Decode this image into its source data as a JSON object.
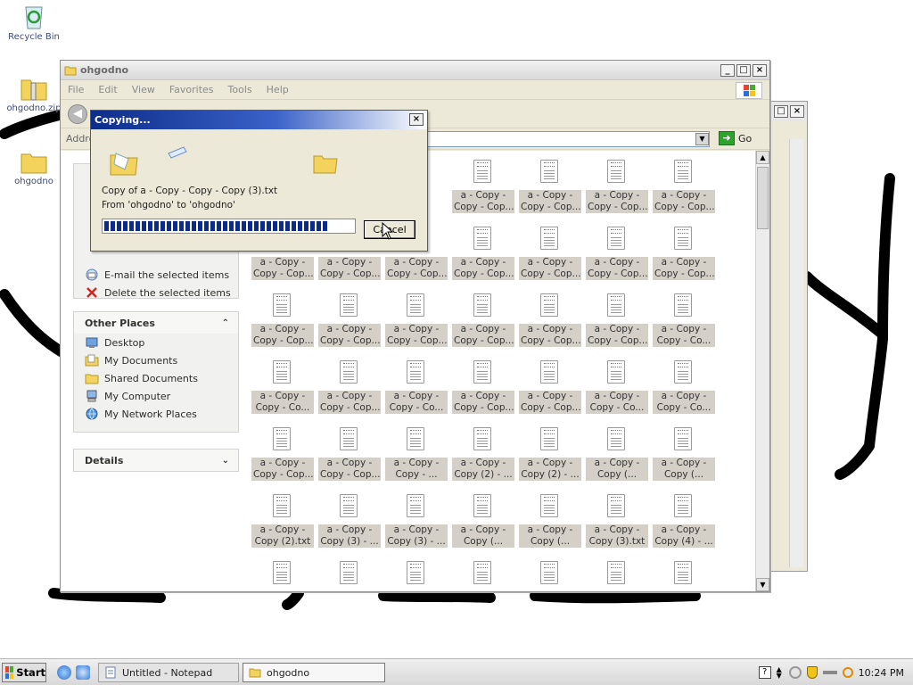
{
  "desktop": {
    "icons": [
      {
        "label": "Recycle Bin"
      },
      {
        "label": "ohgodno.zip"
      },
      {
        "label": "ohgodno"
      }
    ]
  },
  "explorer": {
    "title": "ohgodno",
    "menu": [
      "File",
      "Edit",
      "View",
      "Favorites",
      "Tools",
      "Help"
    ],
    "address_label": "Addre",
    "go_label": "Go",
    "file_tasks": {
      "items": [
        "E-mail the selected items",
        "Delete the selected items"
      ]
    },
    "other_places": {
      "title": "Other Places",
      "items": [
        "Desktop",
        "My Documents",
        "Shared Documents",
        "My Computer",
        "My Network Places"
      ]
    },
    "details": {
      "title": "Details"
    },
    "files": {
      "rows": [
        [
          {
            "l1": "a - Copy -",
            "l2": "Copy - Cop..."
          },
          {
            "l1": "a - Copy -",
            "l2": "Copy - Cop..."
          },
          {
            "l1": "a - Copy -",
            "l2": "Copy - Cop..."
          },
          {
            "l1": "a - Copy -",
            "l2": "Copy - Cop..."
          }
        ],
        [
          {
            "l1": "a - Copy -",
            "l2": "Copy - Cop..."
          },
          {
            "l1": "a - Copy -",
            "l2": "Copy - Cop..."
          },
          {
            "l1": "a - Copy -",
            "l2": "Copy - Cop..."
          },
          {
            "l1": "a - Copy -",
            "l2": "Copy - Cop..."
          },
          {
            "l1": "a - Copy -",
            "l2": "Copy - Cop..."
          },
          {
            "l1": "a - Copy -",
            "l2": "Copy - Cop..."
          },
          {
            "l1": "a - Copy -",
            "l2": "Copy - Cop..."
          }
        ],
        [
          {
            "l1": "a - Copy -",
            "l2": "Copy - Cop..."
          },
          {
            "l1": "a - Copy -",
            "l2": "Copy - Cop..."
          },
          {
            "l1": "a - Copy -",
            "l2": "Copy - Cop..."
          },
          {
            "l1": "a - Copy -",
            "l2": "Copy - Cop..."
          },
          {
            "l1": "a - Copy -",
            "l2": "Copy - Cop..."
          },
          {
            "l1": "a - Copy -",
            "l2": "Copy - Cop..."
          },
          {
            "l1": "a - Copy -",
            "l2": "Copy - Co..."
          }
        ],
        [
          {
            "l1": "a - Copy -",
            "l2": "Copy - Co..."
          },
          {
            "l1": "a - Copy -",
            "l2": "Copy - Cop..."
          },
          {
            "l1": "a - Copy -",
            "l2": "Copy - Co..."
          },
          {
            "l1": "a - Copy -",
            "l2": "Copy - Cop..."
          },
          {
            "l1": "a - Copy -",
            "l2": "Copy - Cop..."
          },
          {
            "l1": "a - Copy -",
            "l2": "Copy - Co..."
          },
          {
            "l1": "a - Copy -",
            "l2": "Copy - Co..."
          }
        ],
        [
          {
            "l1": "a - Copy -",
            "l2": "Copy - Cop..."
          },
          {
            "l1": "a - Copy -",
            "l2": "Copy - Cop..."
          },
          {
            "l1": "a - Copy -",
            "l2": "Copy - ..."
          },
          {
            "l1": "a - Copy -",
            "l2": "Copy (2) - ..."
          },
          {
            "l1": "a - Copy -",
            "l2": "Copy (2) - ..."
          },
          {
            "l1": "a - Copy -",
            "l2": "Copy (..."
          },
          {
            "l1": "a - Copy -",
            "l2": "Copy (..."
          }
        ],
        [
          {
            "l1": "a - Copy -",
            "l2": "Copy (2).txt"
          },
          {
            "l1": "a - Copy -",
            "l2": "Copy (3) - ..."
          },
          {
            "l1": "a - Copy -",
            "l2": "Copy (3) - ..."
          },
          {
            "l1": "a - Copy -",
            "l2": "Copy (..."
          },
          {
            "l1": "a - Copy -",
            "l2": "Copy (..."
          },
          {
            "l1": "a - Copy -",
            "l2": "Copy (3).txt"
          },
          {
            "l1": "a - Copy -",
            "l2": "Copy (4) - ..."
          }
        ]
      ]
    }
  },
  "copy_dialog": {
    "title": "Copying...",
    "file_line": "Copy of a - Copy - Copy - Copy (3).txt",
    "from_line": "From 'ohgodno' to 'ohgodno'",
    "progress": 0.9,
    "cancel_label": "Cancel"
  },
  "taskbar": {
    "start_label": "Start",
    "tasks": [
      {
        "label": "Untitled - Notepad"
      },
      {
        "label": "ohgodno"
      }
    ],
    "clock": "10:24 PM"
  }
}
